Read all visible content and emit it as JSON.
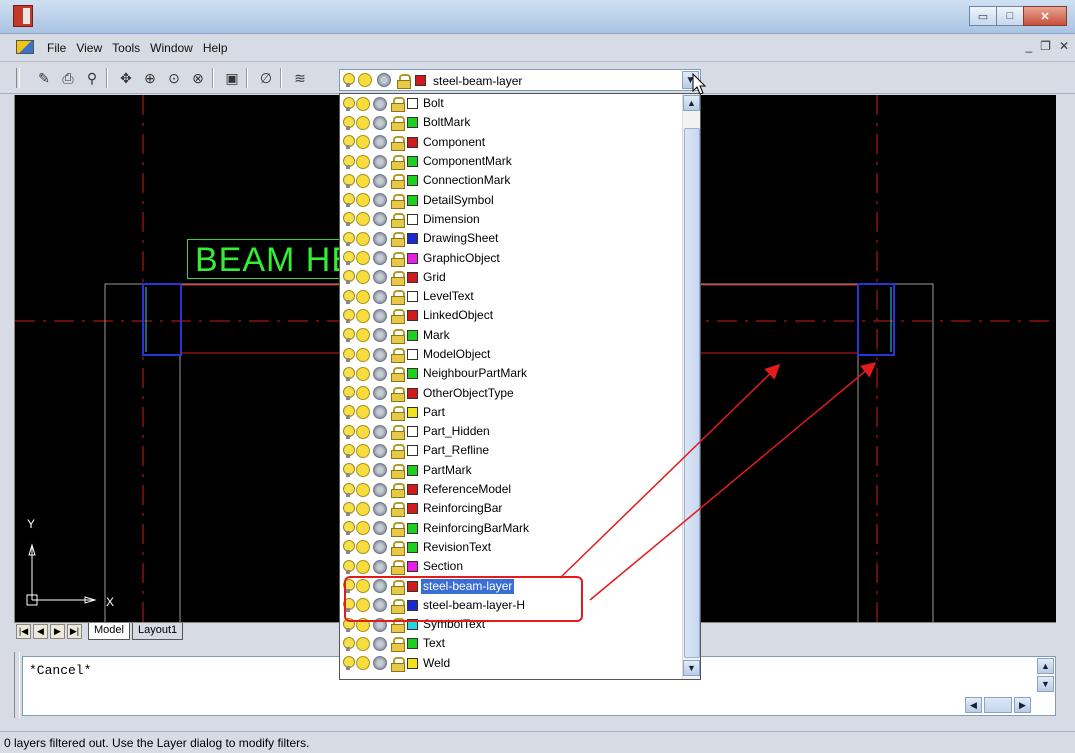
{
  "menu": {
    "items": [
      "File",
      "View",
      "Tools",
      "Window",
      "Help"
    ],
    "mdi_minimize": "_",
    "mdi_restore": "❐",
    "mdi_close": "✕"
  },
  "titlebar": {
    "minimize": "▭",
    "maximize": "□",
    "close": "✕"
  },
  "layer_combo": {
    "value": "steel-beam-layer",
    "swatch": "#d11a1a"
  },
  "layers": [
    {
      "name": "Bolt",
      "color": "#ffffff"
    },
    {
      "name": "BoltMark",
      "color": "#1fcf1f"
    },
    {
      "name": "Component",
      "color": "#d11a1a"
    },
    {
      "name": "ComponentMark",
      "color": "#1fcf1f"
    },
    {
      "name": "ConnectionMark",
      "color": "#1fcf1f"
    },
    {
      "name": "DetailSymbol",
      "color": "#1fcf1f"
    },
    {
      "name": "Dimension",
      "color": "#ffffff"
    },
    {
      "name": "DrawingSheet",
      "color": "#1a2ad1"
    },
    {
      "name": "GraphicObject",
      "color": "#e81ee0"
    },
    {
      "name": "Grid",
      "color": "#d11a1a"
    },
    {
      "name": "LevelText",
      "color": "#ffffff"
    },
    {
      "name": "LinkedObject",
      "color": "#d11a1a"
    },
    {
      "name": "Mark",
      "color": "#1fcf1f"
    },
    {
      "name": "ModelObject",
      "color": "#ffffff"
    },
    {
      "name": "NeighbourPartMark",
      "color": "#1fcf1f"
    },
    {
      "name": "OtherObjectType",
      "color": "#d11a1a"
    },
    {
      "name": "Part",
      "color": "#f3e21b"
    },
    {
      "name": "Part_Hidden",
      "color": "#ffffff"
    },
    {
      "name": "Part_Refline",
      "color": "#ffffff"
    },
    {
      "name": "PartMark",
      "color": "#1fcf1f"
    },
    {
      "name": "ReferenceModel",
      "color": "#d11a1a"
    },
    {
      "name": "ReinforcingBar",
      "color": "#d11a1a"
    },
    {
      "name": "ReinforcingBarMark",
      "color": "#1fcf1f"
    },
    {
      "name": "RevisionText",
      "color": "#1fcf1f"
    },
    {
      "name": "Section",
      "color": "#e81ee0"
    },
    {
      "name": "steel-beam-layer",
      "color": "#d11a1a",
      "selected": true
    },
    {
      "name": "steel-beam-layer-H",
      "color": "#1a2ad1"
    },
    {
      "name": "SymbolText",
      "color": "#22d6e6"
    },
    {
      "name": "Text",
      "color": "#1fcf1f"
    },
    {
      "name": "Weld",
      "color": "#f3e21b"
    }
  ],
  "drawing": {
    "beam_text": "BEAM HE",
    "ucs_y": "Y",
    "ucs_x": "X"
  },
  "tabs": {
    "model": "Model",
    "layout1": "Layout1"
  },
  "command": {
    "text": "*Cancel*"
  },
  "status": {
    "text": "0 layers filtered out.  Use the Layer dialog to modify filters."
  },
  "colors": {
    "annotation": "#e21b1b",
    "selection": "#3a6ed2"
  }
}
